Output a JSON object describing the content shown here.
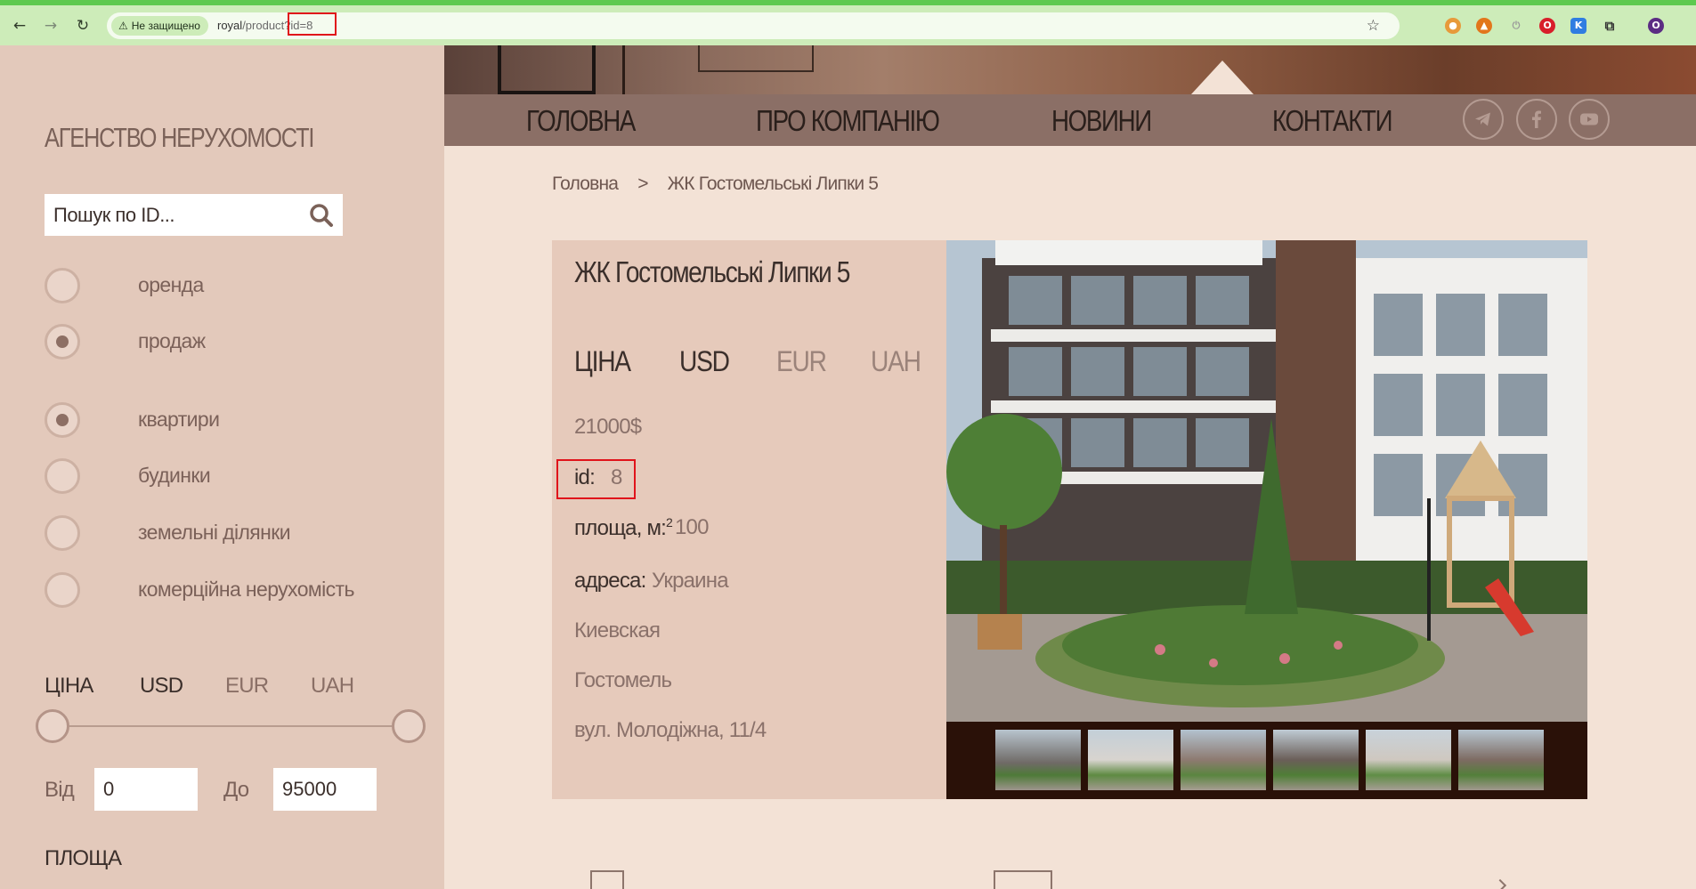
{
  "browser": {
    "back_icon": "arrow-left-icon",
    "forward_icon": "arrow-right-icon",
    "reload_icon": "reload-icon",
    "security_label": "Не защищено",
    "url_host": "royal",
    "url_path": "/produc",
    "url_query": "t?id=8",
    "bookmark_icon": "star-icon"
  },
  "sidebar": {
    "title": "АГЕНСТВО НЕРУХОМОСТІ",
    "search_placeholder": "Пошук по ID...",
    "deal_types": [
      {
        "label": "оренда",
        "checked": false
      },
      {
        "label": "продаж",
        "checked": true
      }
    ],
    "property_types": [
      {
        "label": "квартири",
        "checked": true
      },
      {
        "label": "будинки",
        "checked": false
      },
      {
        "label": "земельні ділянки",
        "checked": false
      },
      {
        "label": "комерційна нерухомість",
        "checked": false
      }
    ],
    "price": {
      "label": "ЦІНА",
      "currencies": [
        "USD",
        "EUR",
        "UAH"
      ],
      "active_currency": "USD",
      "from_label": "Від",
      "from_value": "0",
      "to_label": "До",
      "to_value": "95000"
    },
    "area_label": "ПЛОЩА"
  },
  "nav": {
    "items": [
      "ГОЛОВНА",
      "ПРО КОМПАНІЮ",
      "НОВИНИ",
      "КОНТАКТИ"
    ],
    "social": [
      "telegram-icon",
      "facebook-icon",
      "youtube-icon"
    ]
  },
  "breadcrumb": {
    "home": "Головна",
    "separator": ">",
    "current": "ЖК Гостомельські Липки 5"
  },
  "product": {
    "title": "ЖК Гостомельські Липки 5",
    "price_label": "ЦІНА",
    "currencies": [
      "USD",
      "EUR",
      "UAH"
    ],
    "active_currency": "USD",
    "price": "21000$",
    "id_label": "id:",
    "id_value": "8",
    "area_label": "площа, м:",
    "area_sup": "2",
    "area_value": "100",
    "address_label": "адреса:",
    "address_country": "Украина",
    "address_region": "Киевская",
    "address_city": "Гостомель",
    "address_street": "вул. Молодіжна, 11/4"
  },
  "colors": {
    "sidebar_bg": "#e3c9bb",
    "page_bg": "#f3e2d6",
    "navbar_bg": "#8b6f66",
    "card_bg": "#e6cabb",
    "highlight": "#e0141b",
    "browser_bar": "#cdecb9"
  }
}
